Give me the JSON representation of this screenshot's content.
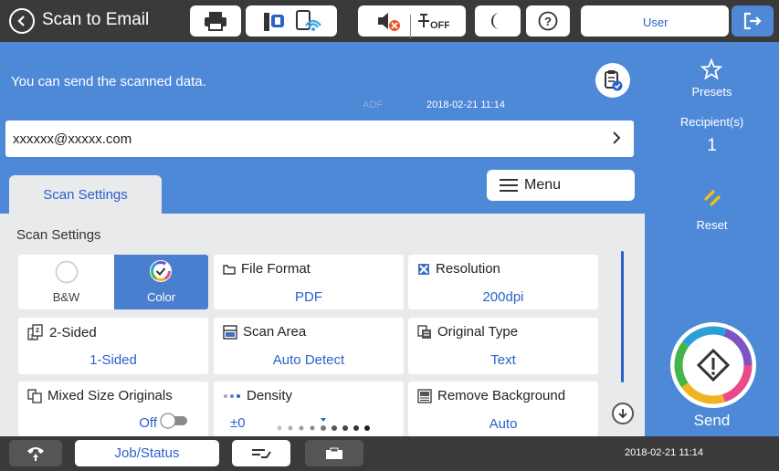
{
  "top_bar": {
    "title": "Scan to Email",
    "user_label": "User"
  },
  "header": {
    "status_message": "You can send the scanned data.",
    "source_label": "ADF",
    "datetime": "2018-02-21 11:14",
    "recipient_address": "xxxxxx@xxxxx.com"
  },
  "tabs": {
    "active_tab": "Scan Settings",
    "menu_label": "Menu"
  },
  "settings": {
    "section_title": "Scan Settings",
    "color_mode": {
      "bw_label": "B&W",
      "color_label": "Color",
      "selected": "Color"
    },
    "file_format": {
      "label": "File Format",
      "value": "PDF"
    },
    "resolution": {
      "label": "Resolution",
      "value": "200dpi"
    },
    "two_sided": {
      "label": "2-Sided",
      "value": "1-Sided"
    },
    "scan_area": {
      "label": "Scan Area",
      "value": "Auto Detect"
    },
    "original_type": {
      "label": "Original Type",
      "value": "Text"
    },
    "mixed_size": {
      "label": "Mixed Size Originals",
      "value": "Off"
    },
    "density": {
      "label": "Density",
      "value": "±0"
    },
    "remove_background": {
      "label": "Remove Background",
      "value": "Auto"
    }
  },
  "right_panel": {
    "presets_label": "Presets",
    "recipients_label": "Recipient(s)",
    "recipients_count": "1",
    "reset_label": "Reset",
    "send_label": "Send"
  },
  "bottom_bar": {
    "job_status_label": "Job/Status",
    "datetime": "2018-02-21 11:14"
  },
  "icons": [
    "back-icon",
    "printer-icon",
    "fax-status-icon",
    "wifi-icon",
    "sound-off-icon",
    "energy-off-icon",
    "sleep-moon-icon",
    "help-icon",
    "logout-icon",
    "clipboard-check-icon",
    "chevron-right-icon",
    "menu-lines-icon",
    "star-icon",
    "reset-slash-icon",
    "send-diamond-icon",
    "fax-call-icon",
    "queue-icon",
    "tray-icon",
    "scroll-down-icon"
  ],
  "colors": {
    "accent_blue": "#4e89d8",
    "link_blue": "#2a62c9",
    "dark_bar": "#3a3a3a",
    "panel_gray": "#e9eaec",
    "reset_yellow": "#f1c40f"
  }
}
